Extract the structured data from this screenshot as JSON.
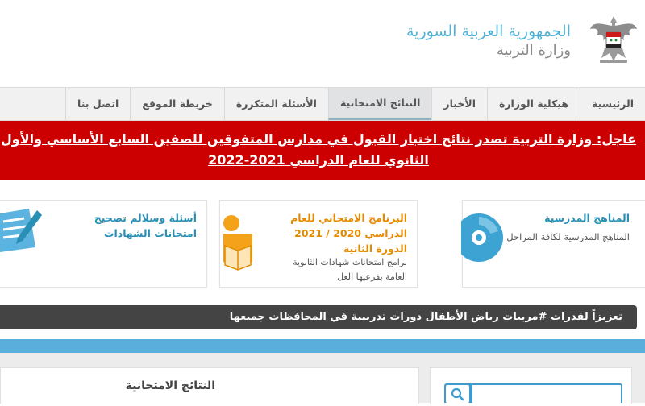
{
  "header": {
    "country": "الجمهورية العربية السورية",
    "ministry": "وزارة التربية"
  },
  "nav": {
    "items": [
      {
        "label": "الرئيسية"
      },
      {
        "label": "هيكلية الوزارة"
      },
      {
        "label": "الأخبار"
      },
      {
        "label": "النتائج الامتحانية",
        "active": true
      },
      {
        "label": "الأسئلة المتكررة"
      },
      {
        "label": "خريطة الموقع"
      },
      {
        "label": "اتصل بنا"
      }
    ]
  },
  "urgent": {
    "label": "عاجل:",
    "headline": " وزارة التربية تصدر نتائج اختبار القبول في مدارس المتفوقين للصفين السابع الأساسي والأول الثانوي للعام الدراسي 2021-2022"
  },
  "cards": [
    {
      "title": "المناهج المدرسية",
      "desc": "المناهج المدرسية لكافة المراحل",
      "icon": "cd-icon"
    },
    {
      "title": "البرنامج الامتحاني للعام الدراسي 2020 / 2021 الدورة الثانية",
      "desc": "برامج امتحانات شهادات الثانوية العامة بفرعيها العل",
      "icon": "reader-icon"
    },
    {
      "title": "أسئلة وسلالم تصحيح امتحانات الشهادات",
      "desc": "",
      "icon": "exam-paper-icon"
    }
  ],
  "ticker": {
    "text": "تعزيزاً لقدرات #مربيات رياض الأطفال دورات تدريبية في المحافظات جميعها"
  },
  "results_panel": {
    "title": "النتائج الامتحانية"
  },
  "search": {
    "placeholder": ""
  },
  "colors": {
    "accent": "#4fb2d4",
    "urgent_bg": "#cc0000",
    "card1_title": "#2a8fb5",
    "card2_title": "#e68a00",
    "card3_title": "#2a8fb5",
    "ticker_bg": "#444444",
    "band": "#5aaedc"
  }
}
